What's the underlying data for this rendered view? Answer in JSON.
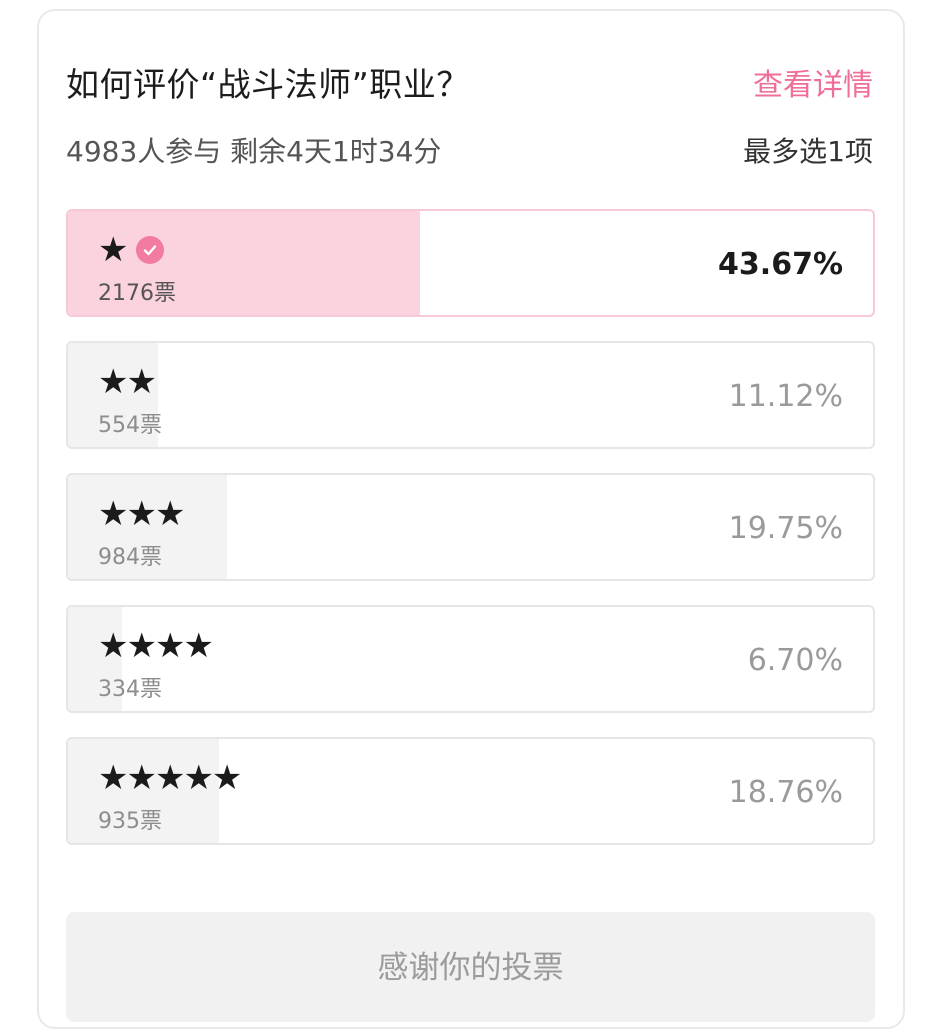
{
  "poll": {
    "title": "如何评价“战斗法师”职业？",
    "detail_link": "查看详情",
    "meta": "4983人参与 剩余4天1时34分",
    "rule": "最多选1项",
    "options": [
      {
        "stars": "★",
        "votes": "2176票",
        "percent": "43.67%",
        "fraction": 0.4367,
        "selected": true
      },
      {
        "stars": "★★",
        "votes": "554票",
        "percent": "11.12%",
        "fraction": 0.1112,
        "selected": false
      },
      {
        "stars": "★★★",
        "votes": "984票",
        "percent": "19.75%",
        "fraction": 0.1975,
        "selected": false
      },
      {
        "stars": "★★★★",
        "votes": "334票",
        "percent": "6.70%",
        "fraction": 0.067,
        "selected": false
      },
      {
        "stars": "★★★★★",
        "votes": "935票",
        "percent": "18.76%",
        "fraction": 0.1876,
        "selected": false
      }
    ],
    "thanks_button": "感谢你的投票"
  },
  "colors": {
    "accent": "#ef6f97",
    "selected_fill": "#fbd3de",
    "unselected_fill": "#f3f3f3"
  },
  "icons": {
    "selected_marker": "check-circle-icon",
    "rating": "star-icon"
  }
}
